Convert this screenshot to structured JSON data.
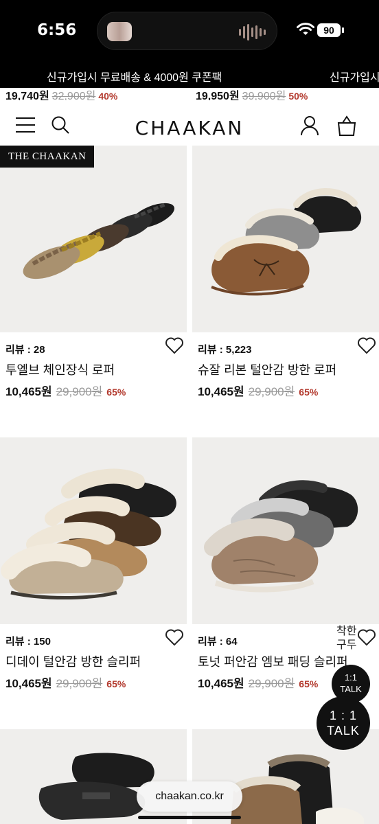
{
  "status": {
    "time": "6:56",
    "battery": "90"
  },
  "promo": {
    "text": "신규가입시 무료배송 & 4000원 쿠폰팩",
    "repeat": "신규가입시"
  },
  "peek": [
    {
      "price": "19,740원",
      "original": "32,900원",
      "discount": "40%"
    },
    {
      "price": "19,950원",
      "original": "39,900원",
      "discount": "50%"
    }
  ],
  "header": {
    "logo": "CHAAKAN"
  },
  "badge": "THE CHAAKAN",
  "products": [
    {
      "review": "리뷰 : 28",
      "name": "투엘브 체인장식 로퍼",
      "price": "10,465원",
      "original": "29,900원",
      "discount": "65%"
    },
    {
      "review": "리뷰 : 5,223",
      "name": "슈잘 리본 털안감 방한 로퍼",
      "price": "10,465원",
      "original": "29,900원",
      "discount": "65%"
    },
    {
      "review": "리뷰 : 150",
      "name": "디데이 털안감 방한 슬리퍼",
      "price": "10,465원",
      "original": "29,900원",
      "discount": "65%"
    },
    {
      "review": "리뷰 : 64",
      "name": "토넛 퍼안감 엠보 패딩 슬리퍼",
      "price": "10,465원",
      "original": "29,900원",
      "discount": "65%"
    }
  ],
  "floating": {
    "text_line1": "착한",
    "text_line2": "구두",
    "talk_small_1": "1:1",
    "talk_small_2": "TALK",
    "talk_big_1": "1 : 1",
    "talk_big_2": "TALK"
  },
  "url": "chaakan.co.kr",
  "colors": {
    "discount": "#b33a2e",
    "promo_bg": "#000000"
  }
}
